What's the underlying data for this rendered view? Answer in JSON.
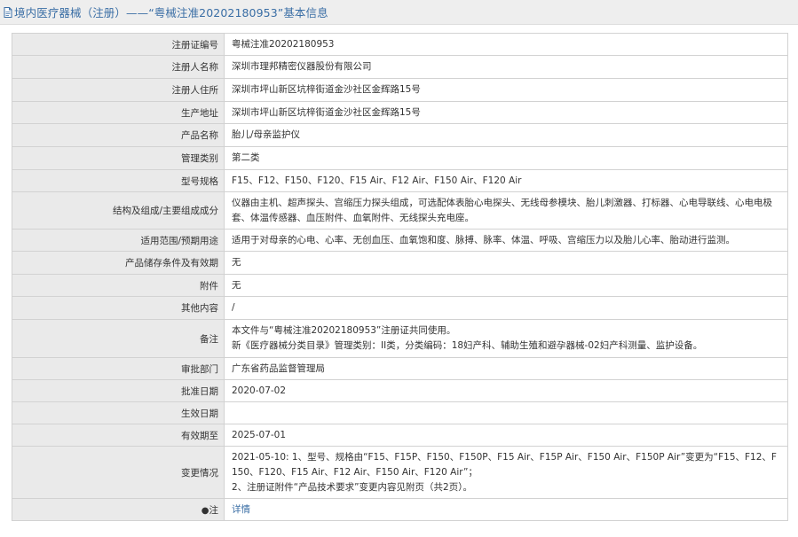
{
  "header": {
    "title": "境内医疗器械（注册）——“粤械注准20202180953”基本信息",
    "icon": "document-icon",
    "color": "#3a6ea5"
  },
  "rows": [
    {
      "key": "reg_no",
      "label": "注册证编号",
      "value": "粤械注准20202180953"
    },
    {
      "key": "registrant_name",
      "label": "注册人名称",
      "value": "深圳市理邦精密仪器股份有限公司"
    },
    {
      "key": "registrant_address",
      "label": "注册人住所",
      "value": "深圳市坪山新区坑梓街道金沙社区金辉路15号"
    },
    {
      "key": "production_address",
      "label": "生产地址",
      "value": "深圳市坪山新区坑梓街道金沙社区金辉路15号"
    },
    {
      "key": "product_name",
      "label": "产品名称",
      "value": "胎儿/母亲监护仪"
    },
    {
      "key": "management_category",
      "label": "管理类别",
      "value": "第二类"
    },
    {
      "key": "model_spec",
      "label": "型号规格",
      "value": "F15、F12、F150、F120、F15 Air、F12 Air、F150 Air、F120 Air"
    },
    {
      "key": "structure",
      "label": "结构及组成/主要组成成分",
      "value": "仪器由主机、超声探头、宫缩压力探头组成，可选配体表胎心电探头、无线母参模块、胎儿刺激器、打标器、心电导联线、心电电极套、体温传感器、血压附件、血氧附件、无线探头充电座。"
    },
    {
      "key": "intended_use",
      "label": "适用范围/预期用途",
      "value": "适用于对母亲的心电、心率、无创血压、血氧饱和度、脉搏、脉率、体温、呼吸、宫缩压力以及胎儿心率、胎动进行监测。"
    },
    {
      "key": "storage",
      "label": "产品储存条件及有效期",
      "value": "无"
    },
    {
      "key": "attachment",
      "label": "附件",
      "value": "无"
    },
    {
      "key": "other",
      "label": "其他内容",
      "value": "/"
    },
    {
      "key": "remarks",
      "label": "备注",
      "lines": [
        "本文件与“粤械注准20202180953”注册证共同使用。",
        "新《医疗器械分类目录》管理类别：II类，分类编码：18妇产科、辅助生殖和避孕器械-02妇产科测量、监护设备。"
      ]
    },
    {
      "key": "approval_dept",
      "label": "审批部门",
      "value": "广东省药品监督管理局"
    },
    {
      "key": "approval_date",
      "label": "批准日期",
      "value": "2020-07-02"
    },
    {
      "key": "effective_date",
      "label": "生效日期",
      "value": ""
    },
    {
      "key": "expiry_date",
      "label": "有效期至",
      "value": "2025-07-01"
    },
    {
      "key": "change_info",
      "label": "变更情况",
      "lines": [
        "2021-05-10: 1、型号、规格由“F15、F15P、F150、F150P、F15 Air、F15P Air、F150 Air、F150P Air”变更为“F15、F12、F150、F120、F15 Air、F12 Air、F150 Air、F120 Air”；",
        "2、注册证附件“产品技术要求”变更内容见附页（共2页）。"
      ]
    },
    {
      "key": "note",
      "label": "注",
      "bullet": "●",
      "value": "详情"
    }
  ]
}
